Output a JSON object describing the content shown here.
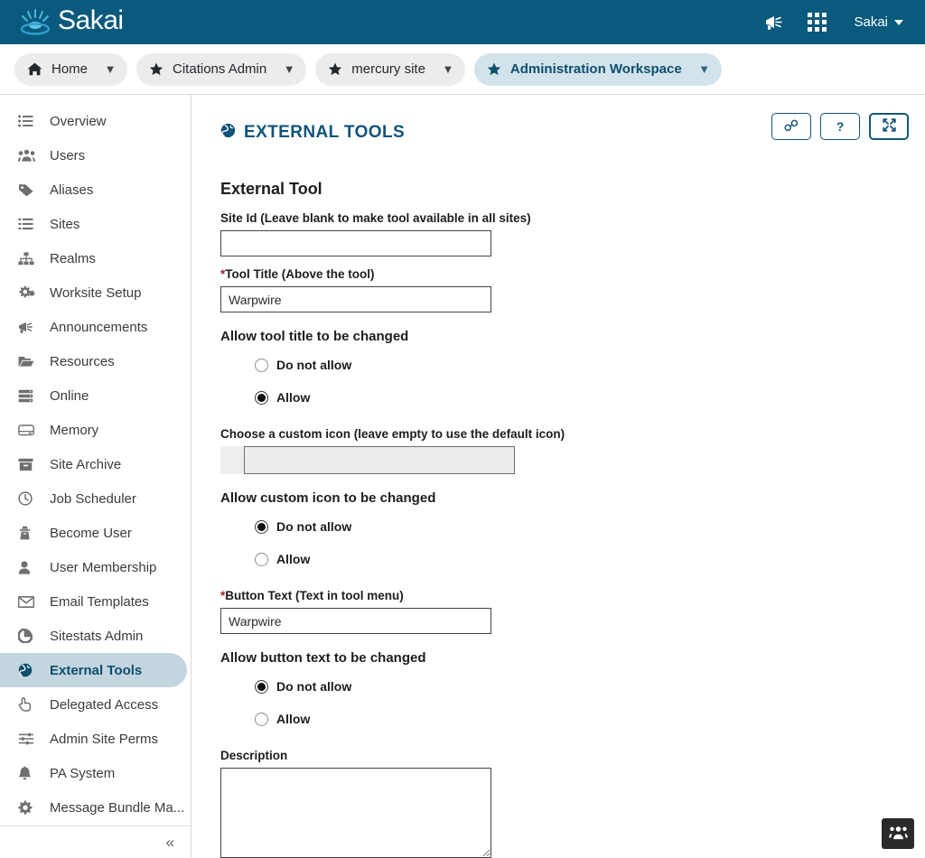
{
  "header": {
    "brand": "Sakai",
    "logo_icon": "sakai-droplet-logo",
    "announcements_icon": "megaphone-icon",
    "apps_icon": "grid-apps-icon",
    "user_name": "Sakai",
    "user_caret_icon": "chevron-down-icon"
  },
  "site_tabs": [
    {
      "label": "Home",
      "icon": "home-icon",
      "active": false,
      "caret": "chevron-down-icon"
    },
    {
      "label": "Citations Admin",
      "icon": "star-icon",
      "active": false,
      "caret": "chevron-down-icon"
    },
    {
      "label": "mercury site",
      "icon": "star-icon",
      "active": false,
      "caret": "chevron-down-icon"
    },
    {
      "label": "Administration Workspace",
      "icon": "star-icon",
      "active": true,
      "caret": "chevron-down-icon"
    }
  ],
  "sidebar": {
    "items": [
      {
        "label": "Overview",
        "icon": "list-icon",
        "active": false
      },
      {
        "label": "Users",
        "icon": "users-group-icon",
        "active": false
      },
      {
        "label": "Aliases",
        "icon": "tag-icon",
        "active": false
      },
      {
        "label": "Sites",
        "icon": "list-alt-icon",
        "active": false
      },
      {
        "label": "Realms",
        "icon": "sitemap-icon",
        "active": false
      },
      {
        "label": "Worksite Setup",
        "icon": "gears-icon",
        "active": false
      },
      {
        "label": "Announcements",
        "icon": "bullhorn-icon",
        "active": false
      },
      {
        "label": "Resources",
        "icon": "folder-open-icon",
        "active": false
      },
      {
        "label": "Online",
        "icon": "server-icon",
        "active": false
      },
      {
        "label": "Memory",
        "icon": "hard-drive-icon",
        "active": false
      },
      {
        "label": "Site Archive",
        "icon": "archive-box-icon",
        "active": false
      },
      {
        "label": "Job Scheduler",
        "icon": "clock-icon",
        "active": false
      },
      {
        "label": "Become User",
        "icon": "user-secret-icon",
        "active": false
      },
      {
        "label": "User Membership",
        "icon": "user-icon",
        "active": false
      },
      {
        "label": "Email Templates",
        "icon": "envelope-icon",
        "active": false
      },
      {
        "label": "Sitestats Admin",
        "icon": "pie-chart-icon",
        "active": false
      },
      {
        "label": "External Tools",
        "icon": "globe-icon",
        "active": true
      },
      {
        "label": "Delegated Access",
        "icon": "hand-pointer-icon",
        "active": false
      },
      {
        "label": "Admin Site Perms",
        "icon": "sliders-icon",
        "active": false
      },
      {
        "label": "PA System",
        "icon": "bell-icon",
        "active": false
      },
      {
        "label": "Message Bundle Ma...",
        "icon": "gear-icon",
        "active": false
      }
    ],
    "collapse_icon": "chevron-double-left-icon"
  },
  "tool": {
    "title": "EXTERNAL TOOLS",
    "title_icon": "globe-icon",
    "actions": [
      {
        "name": "permalink-button",
        "icon": "link-icon",
        "label": "⚭"
      },
      {
        "name": "help-button",
        "icon": "question-mark-icon",
        "label": "?"
      },
      {
        "name": "fullscreen-button",
        "icon": "expand-arrows-icon",
        "label": "⤢"
      }
    ]
  },
  "form": {
    "heading": "External Tool",
    "site_id": {
      "label": "Site Id (Leave blank to make tool available in all sites)",
      "value": "",
      "placeholder": ""
    },
    "tool_title": {
      "label": "Tool Title (Above the tool)",
      "required_marker": "*",
      "value": "Warpwire",
      "placeholder": ""
    },
    "allow_tool_title": {
      "label": "Allow tool title to be changed",
      "options": [
        {
          "label": "Do not allow",
          "selected": false
        },
        {
          "label": "Allow",
          "selected": true
        }
      ]
    },
    "custom_icon": {
      "label": "Choose a custom icon (leave empty to use the default icon)",
      "value": "",
      "disabled": true
    },
    "allow_custom_icon": {
      "label": "Allow custom icon to be changed",
      "options": [
        {
          "label": "Do not allow",
          "selected": true
        },
        {
          "label": "Allow",
          "selected": false
        }
      ]
    },
    "button_text": {
      "label": "Button Text (Text in tool menu)",
      "required_marker": "*",
      "value": "Warpwire",
      "placeholder": ""
    },
    "allow_button_text": {
      "label": "Allow button text to be changed",
      "options": [
        {
          "label": "Do not allow",
          "selected": true
        },
        {
          "label": "Allow",
          "selected": false
        }
      ]
    },
    "description": {
      "label": "Description",
      "value": "",
      "placeholder": ""
    }
  },
  "float_button": {
    "icon": "users-group-icon"
  },
  "colors": {
    "header_blue": "#0a5a7d",
    "accent_blue": "#10547a",
    "active_tab_bg": "#d3e3ec",
    "active_nav_bg": "#c3d5de",
    "required_red": "#9c1e35"
  }
}
